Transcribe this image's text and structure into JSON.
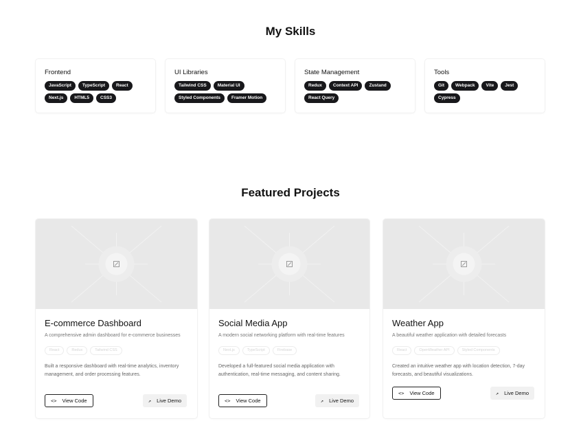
{
  "skills_section": {
    "title": "My Skills",
    "categories": [
      {
        "name": "Frontend",
        "skills": [
          "JavaScript",
          "TypeScript",
          "React",
          "Next.js",
          "HTML5",
          "CSS3"
        ]
      },
      {
        "name": "UI Libraries",
        "skills": [
          "Tailwind CSS",
          "Material UI",
          "Styled Components",
          "Framer Motion"
        ]
      },
      {
        "name": "State Management",
        "skills": [
          "Redux",
          "Context API",
          "Zustand",
          "React Query"
        ]
      },
      {
        "name": "Tools",
        "skills": [
          "Git",
          "Webpack",
          "Vite",
          "Jest",
          "Cypress"
        ]
      }
    ]
  },
  "projects_section": {
    "title": "Featured Projects",
    "projects": [
      {
        "title": "E-commerce Dashboard",
        "description": "A comprehensive admin dashboard for e-commerce businesses",
        "tags": [
          "React",
          "Redux",
          "Tailwind CSS"
        ],
        "details": "Built a responsive dashboard with real-time analytics, inventory management, and order processing features.",
        "code_label": "View Code",
        "demo_label": "Live Demo"
      },
      {
        "title": "Social Media App",
        "description": "A modern social networking platform with real-time features",
        "tags": [
          "Next.js",
          "TypeScript",
          "Firebase"
        ],
        "details": "Developed a full-featured social media application with authentication, real-time messaging, and content sharing.",
        "code_label": "View Code",
        "demo_label": "Live Demo"
      },
      {
        "title": "Weather App",
        "description": "A beautiful weather application with detailed forecasts",
        "tags": [
          "React",
          "OpenWeather API",
          "Styled Components"
        ],
        "details": "Created an intuitive weather app with location detection, 7-day forecasts, and beautiful visualizations.",
        "code_label": "View Code",
        "demo_label": "Live Demo"
      }
    ]
  },
  "icons": {
    "code": "code-icon",
    "external": "external-link-icon",
    "placeholder": "image-placeholder-icon"
  },
  "colors": {
    "chip_bg": "#18181b",
    "image_placeholder": "#e8e8e8",
    "demo_button_bg": "#f1f1f1"
  }
}
